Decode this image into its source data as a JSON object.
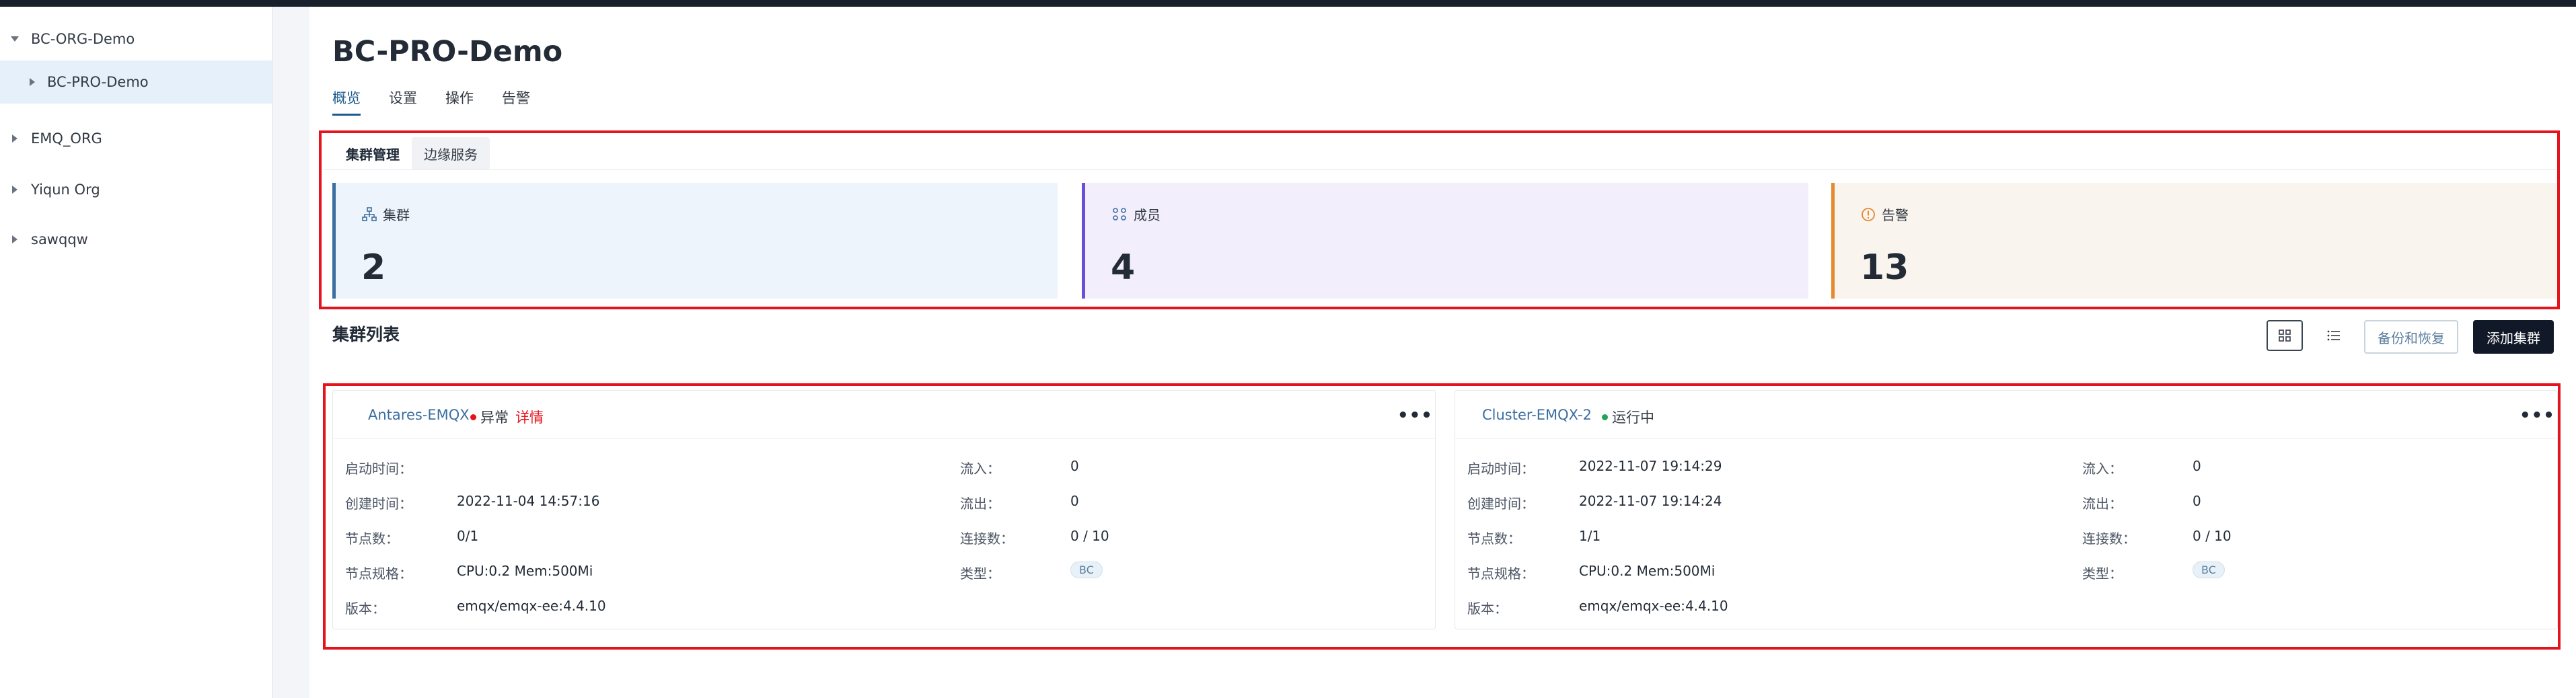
{
  "sidebar": {
    "items": [
      {
        "label": "BC-ORG-Demo",
        "expanded": true,
        "selected": false
      },
      {
        "label": "BC-PRO-Demo",
        "expanded": false,
        "selected": true
      },
      {
        "label": "EMQ_ORG",
        "expanded": false,
        "selected": false
      },
      {
        "label": "Yiqun Org",
        "expanded": false,
        "selected": false
      },
      {
        "label": "sawqqw",
        "expanded": false,
        "selected": false
      }
    ]
  },
  "page": {
    "title": "BC-PRO-Demo",
    "tabs": [
      {
        "label": "概览",
        "active": true
      },
      {
        "label": "设置",
        "active": false
      },
      {
        "label": "操作",
        "active": false
      },
      {
        "label": "告警",
        "active": false
      }
    ]
  },
  "subtabs": [
    {
      "label": "集群管理",
      "active": true
    },
    {
      "label": "边缘服务",
      "active": false
    }
  ],
  "stats": [
    {
      "label": "集群",
      "value": "2",
      "icon": "cluster-icon",
      "accent": "#3b6fa0",
      "bg": "#eef4fb"
    },
    {
      "label": "成员",
      "value": "4",
      "icon": "members-icon",
      "accent": "#6b4fd8",
      "bg": "#f2eefc"
    },
    {
      "label": "告警",
      "value": "13",
      "icon": "alert-icon",
      "accent": "#e58a2e",
      "bg": "#faf4ee"
    }
  ],
  "cluster_list": {
    "title": "集群列表",
    "backup_label": "备份和恢复",
    "add_label": "添加集群"
  },
  "clusters": [
    {
      "name": "Antares-EMQX",
      "status": "异常",
      "status_color": "#e5141c",
      "detail_label": "详情",
      "more": "•••",
      "left": [
        {
          "k": "启动时间：",
          "v": ""
        },
        {
          "k": "创建时间：",
          "v": "2022-11-04 14:57:16"
        },
        {
          "k": "节点数：",
          "v": "0/1"
        },
        {
          "k": "节点规格：",
          "v": "CPU:0.2 Mem:500Mi"
        },
        {
          "k": "版本：",
          "v": "emqx/emqx-ee:4.4.10"
        }
      ],
      "right": [
        {
          "k": "流入：",
          "v": "0"
        },
        {
          "k": "流出：",
          "v": "0"
        },
        {
          "k": "连接数：",
          "v": "0 / 10"
        },
        {
          "k": "类型：",
          "v": "BC"
        }
      ]
    },
    {
      "name": "Cluster-EMQX-2",
      "status": "运行中",
      "status_color": "#22a35a",
      "detail_label": "",
      "more": "•••",
      "left": [
        {
          "k": "启动时间：",
          "v": "2022-11-07 19:14:29"
        },
        {
          "k": "创建时间：",
          "v": "2022-11-07 19:14:24"
        },
        {
          "k": "节点数：",
          "v": "1/1"
        },
        {
          "k": "节点规格：",
          "v": "CPU:0.2 Mem:500Mi"
        },
        {
          "k": "版本：",
          "v": "emqx/emqx-ee:4.4.10"
        }
      ],
      "right": [
        {
          "k": "流入：",
          "v": "0"
        },
        {
          "k": "流出：",
          "v": "0"
        },
        {
          "k": "连接数：",
          "v": "0 / 10"
        },
        {
          "k": "类型：",
          "v": "BC"
        }
      ]
    }
  ]
}
